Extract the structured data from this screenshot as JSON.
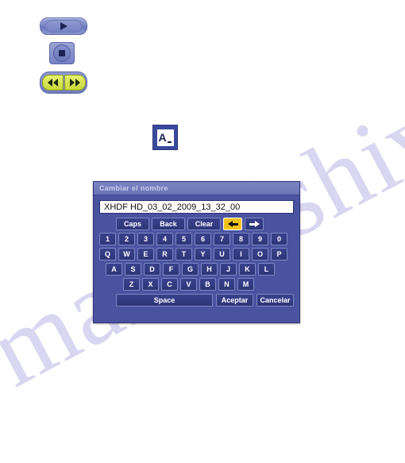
{
  "watermark": {
    "text": "manualshive.com"
  },
  "toolbar": {
    "play_label": "play-icon",
    "stop_label": "stop-icon",
    "rewind_label": "rewind-icon",
    "forward_label": "fast-forward-icon",
    "rename_label": "rename-icon",
    "rename_letter": "A"
  },
  "dialog": {
    "title": "Cambiar el nombre",
    "input": {
      "value": "XHDF HD_03_02_2009_13_32_00",
      "placeholder": ""
    },
    "function_keys": [
      {
        "label": "Caps",
        "type": "wide"
      },
      {
        "label": "Back",
        "type": "wide"
      },
      {
        "label": "Clear",
        "type": "wide"
      },
      {
        "label": "",
        "type": "arrow-left",
        "selected": true
      },
      {
        "label": "",
        "type": "arrow-right",
        "selected": false
      }
    ],
    "rows": [
      {
        "name": "digits",
        "keys": [
          "1",
          "2",
          "3",
          "4",
          "5",
          "6",
          "7",
          "8",
          "9",
          "0"
        ]
      },
      {
        "name": "qwerty",
        "keys": [
          "Q",
          "W",
          "E",
          "R",
          "T",
          "Y",
          "U",
          "I",
          "O",
          "P"
        ]
      },
      {
        "name": "asdf",
        "keys": [
          "A",
          "S",
          "D",
          "F",
          "G",
          "H",
          "J",
          "K",
          "L"
        ]
      },
      {
        "name": "zxcv",
        "keys": [
          "Z",
          "X",
          "C",
          "V",
          "B",
          "N",
          "M"
        ]
      }
    ],
    "space_label": "Space",
    "accept_label": "Aceptar",
    "cancel_label": "Cancelar",
    "colors": {
      "dialog_bg": "#4a539f",
      "titlebar_bg": "#6a74b7",
      "key_bg": "#333b82",
      "key_border": "#7e87c4",
      "selected_key_bg": "#f2c21a",
      "input_bg": "#ffffff",
      "text": "#ffffff"
    }
  }
}
